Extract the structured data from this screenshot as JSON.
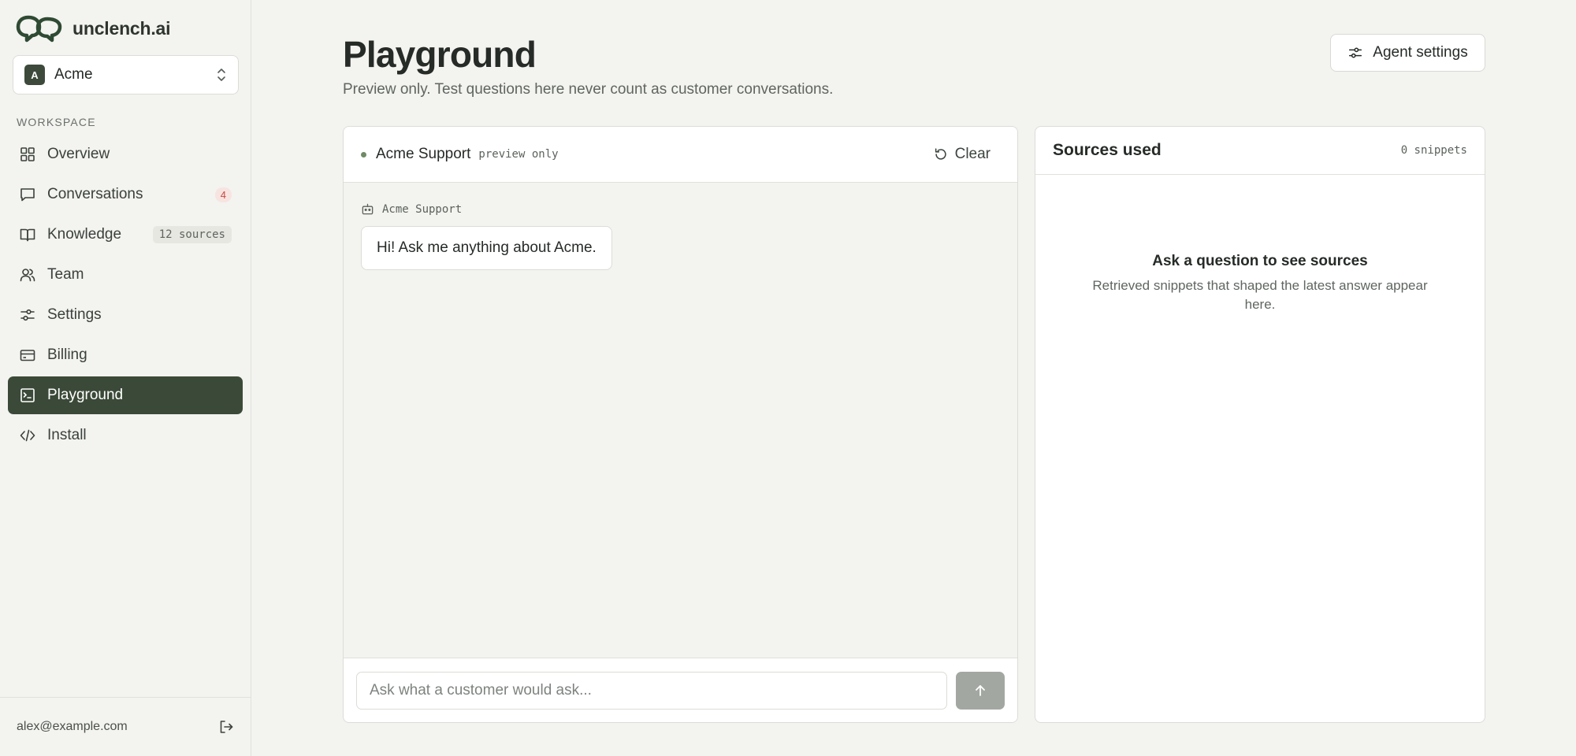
{
  "brand": {
    "name": "unclench.ai"
  },
  "workspace_select": {
    "initial": "A",
    "name": "Acme"
  },
  "sidebar": {
    "section_label": "WORKSPACE",
    "items": [
      {
        "label": "Overview",
        "icon": "grid-icon"
      },
      {
        "label": "Conversations",
        "icon": "chat-icon",
        "badge": "4"
      },
      {
        "label": "Knowledge",
        "icon": "book-icon",
        "badge": "12 sources"
      },
      {
        "label": "Team",
        "icon": "users-icon"
      },
      {
        "label": "Settings",
        "icon": "sliders-icon"
      },
      {
        "label": "Billing",
        "icon": "credit-card-icon"
      },
      {
        "label": "Playground",
        "icon": "playground-icon",
        "active": true
      },
      {
        "label": "Install",
        "icon": "code-icon"
      }
    ],
    "user_email": "alex@example.com"
  },
  "header": {
    "title": "Playground",
    "subtitle": "Preview only. Test questions here never count as customer conversations.",
    "agent_settings_label": "Agent settings"
  },
  "chat": {
    "agent_name": "Acme Support",
    "preview_tag": "preview only",
    "clear_label": "Clear",
    "messages": [
      {
        "author": "Acme Support",
        "text": "Hi! Ask me anything about Acme."
      }
    ],
    "input_placeholder": "Ask what a customer would ask..."
  },
  "sources": {
    "title": "Sources used",
    "count_label": "0 snippets",
    "empty_title": "Ask a question to see sources",
    "empty_text": "Retrieved snippets that shaped the latest answer appear here."
  },
  "colors": {
    "accent": "#3b4a38",
    "background": "#f3f3f0",
    "badge_red": "#c74b3f"
  }
}
